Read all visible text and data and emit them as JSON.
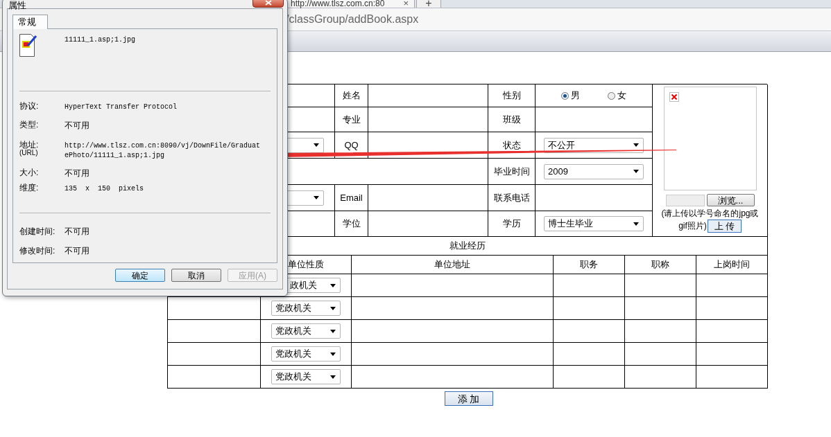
{
  "browser": {
    "tab_title": "http://www.tlsz.com.cn:80",
    "tab_close": "×",
    "new_tab": "+",
    "address": "/classGroup/addBook.aspx"
  },
  "form": {
    "name_label": "姓名",
    "gender_label": "性别",
    "gender_options": [
      {
        "label": "男",
        "selected": true
      },
      {
        "label": "女",
        "selected": false
      }
    ],
    "major_label": "专业",
    "class_label": "班级",
    "qq_label": "QQ",
    "status_label": "状态",
    "status_value": "不公开",
    "grad_label": "毕业时间",
    "grad_value": "2009",
    "email_label": "Email",
    "phone_label": "联系电话",
    "degree_label": "学位",
    "edu_label": "学历",
    "edu_value": "博士生毕业"
  },
  "photo": {
    "browse_button": "浏览...",
    "hint_lines": [
      "(请上传以学号命名的jpg或",
      "gif照片)"
    ],
    "upload_button": "上 传"
  },
  "employment": {
    "title": "就业经历",
    "columns": [
      "单位性质",
      "单位地址",
      "职务",
      "职称",
      "上岗时间"
    ],
    "rows": [
      {
        "unit_type": "政机关",
        "cut_left": true
      },
      {
        "unit_type": "党政机关",
        "cut_left": false
      },
      {
        "unit_type": "党政机关",
        "cut_left": false
      },
      {
        "unit_type": "党政机关",
        "cut_left": false
      },
      {
        "unit_type": "党政机关",
        "cut_left": false
      }
    ]
  },
  "add_button": "添 加",
  "dialog": {
    "title": "属性",
    "tabs": [
      {
        "label": "常规",
        "selected": true
      }
    ],
    "file_name": "11111_1.asp;1.jpg",
    "properties": [
      {
        "label": "协议:",
        "value": "HyperText Transfer Protocol",
        "kind": "code"
      },
      {
        "label": "类型:",
        "value": "不可用",
        "kind": "text"
      },
      {
        "label": "地址:",
        "sublabel": "(URL)",
        "value": "http://www.tlsz.com.cn:8090/vj/DownFile/GraduatePhoto/11111_1.asp;1.jpg",
        "kind": "code"
      },
      {
        "label": "大小:",
        "value": "不可用",
        "kind": "text"
      },
      {
        "label": "维度:",
        "value": "135  x  150  pixels",
        "kind": "code"
      }
    ],
    "times": [
      {
        "label": "创建时间:",
        "value": "不可用"
      },
      {
        "label": "修改时间:",
        "value": "不可用"
      }
    ],
    "buttons": [
      {
        "label": "确定",
        "default": true,
        "disabled": false
      },
      {
        "label": "取消",
        "default": false,
        "disabled": false
      },
      {
        "label": "应用(A)",
        "default": false,
        "disabled": true
      }
    ]
  }
}
